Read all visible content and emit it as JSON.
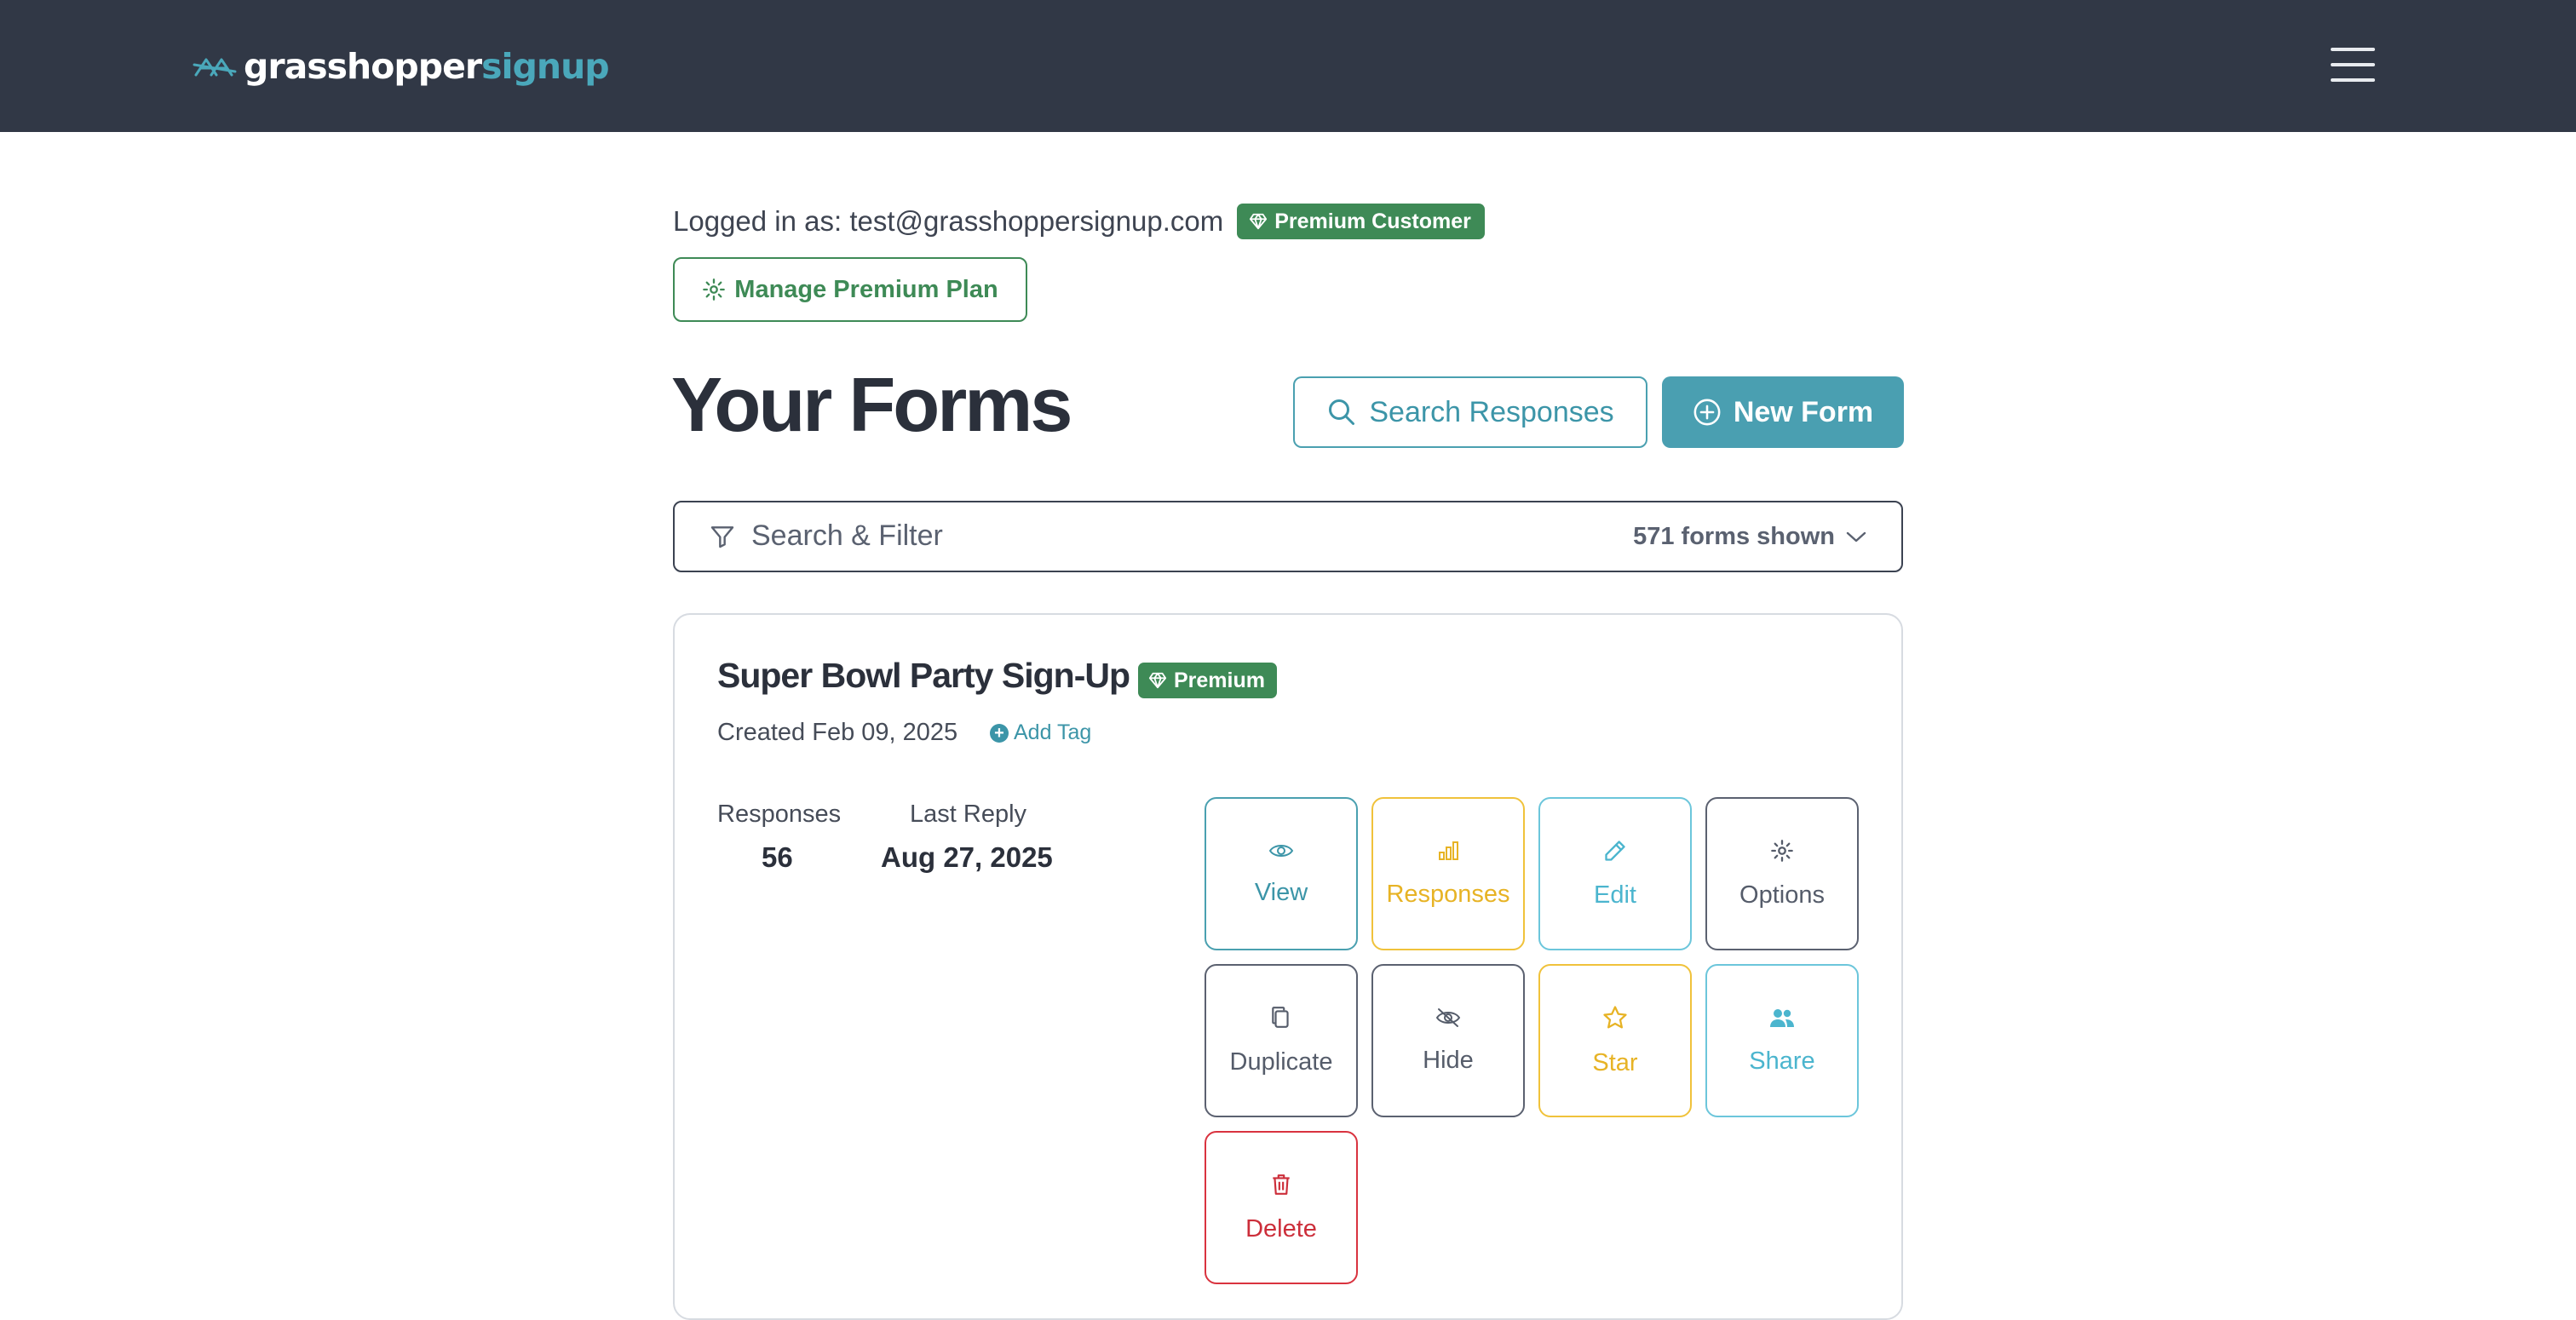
{
  "header": {
    "logo_part1": "grasshopper",
    "logo_part2": "signup",
    "menu_icon": "hamburger-menu-icon"
  },
  "account": {
    "logged_in_text": "Logged in as: test@grasshoppersignup.com",
    "badge": "Premium Customer",
    "manage_button": "Manage Premium Plan"
  },
  "page": {
    "title": "Your Forms",
    "search_responses": "Search Responses",
    "new_form": "New Form"
  },
  "filter": {
    "label": "Search & Filter",
    "count": "571 forms shown"
  },
  "form_card": {
    "title": "Super Bowl Party Sign-Up",
    "badge": "Premium",
    "created": "Created Feb 09, 2025",
    "add_tag": "Add Tag",
    "responses_label": "Responses",
    "responses_value": "56",
    "last_reply_label": "Last Reply",
    "last_reply_value": "Aug 27, 2025",
    "actions": {
      "view": "View",
      "responses": "Responses",
      "edit": "Edit",
      "options": "Options",
      "duplicate": "Duplicate",
      "hide": "Hide",
      "star": "Star",
      "share": "Share",
      "delete": "Delete"
    }
  },
  "colors": {
    "topbar": "#313846",
    "brand_teal": "#4a9fb1",
    "premium_green": "#3e8a56",
    "amber": "#f0c23b",
    "sky": "#6cc6db",
    "danger": "#d9333f"
  }
}
